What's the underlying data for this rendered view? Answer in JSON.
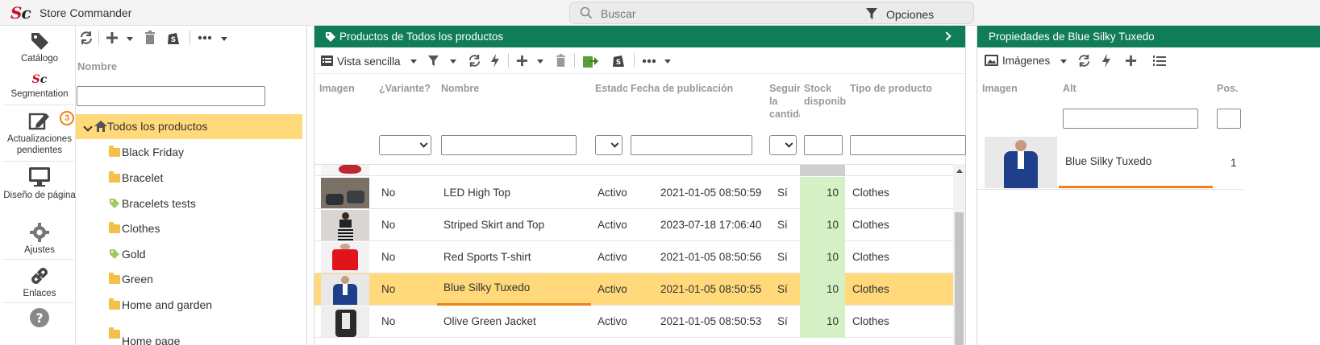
{
  "app": {
    "logo": "Sc",
    "title": "Store Commander"
  },
  "search": {
    "placeholder": "Buscar",
    "options_label": "Opciones"
  },
  "nav": [
    {
      "label": "Catálogo",
      "icon": "tag-icon"
    },
    {
      "label": "Segmentation",
      "icon": "sc-logo-icon"
    },
    {
      "label": "Actualizaciones pendientes",
      "icon": "edit-icon",
      "badge": "3"
    },
    {
      "label": "Diseño de página",
      "icon": "monitor-icon"
    },
    {
      "label": "Ajustes",
      "icon": "gear-icon"
    },
    {
      "label": "Enlaces",
      "icon": "link-icon"
    },
    {
      "label": "",
      "icon": "help-icon"
    }
  ],
  "tree": {
    "column_header": "Nombre",
    "items": [
      {
        "label": "Todos los productos",
        "type": "home",
        "selected": true
      },
      {
        "label": "Black Friday",
        "type": "folder"
      },
      {
        "label": "Bracelet",
        "type": "folder"
      },
      {
        "label": "Bracelets tests",
        "type": "tag"
      },
      {
        "label": "Clothes",
        "type": "folder"
      },
      {
        "label": "Gold",
        "type": "tag"
      },
      {
        "label": "Green",
        "type": "folder"
      },
      {
        "label": "Home and garden",
        "type": "folder"
      },
      {
        "label": "Home page",
        "type": "folder"
      }
    ]
  },
  "products": {
    "title": "Productos de Todos los productos",
    "view_label": "Vista sencilla",
    "columns": {
      "image": "Imagen",
      "variant": "¿Variante?",
      "name": "Nombre",
      "status": "Estado",
      "date": "Fecha de publicación",
      "track": "Seguir la cantidad",
      "stock": "Stock disponible",
      "type": "Tipo de producto"
    },
    "rows": [
      {
        "variant": "No",
        "name": "LED High Top",
        "status": "Activo",
        "date": "2021-01-05 08:50:59",
        "track": "Sí",
        "stock": "10",
        "type": "Clothes",
        "thumb": "shoes"
      },
      {
        "variant": "No",
        "name": "Striped Skirt and Top",
        "status": "Activo",
        "date": "2023-07-18 17:06:40",
        "track": "Sí",
        "stock": "10",
        "type": "Clothes",
        "thumb": "skirt"
      },
      {
        "variant": "No",
        "name": "Red Sports T-shirt",
        "status": "Activo",
        "date": "2021-01-05 08:50:56",
        "track": "Sí",
        "stock": "10",
        "type": "Clothes",
        "thumb": "tshirt"
      },
      {
        "variant": "No",
        "name": "Blue Silky Tuxedo",
        "status": "Activo",
        "date": "2021-01-05 08:50:55",
        "track": "Sí",
        "stock": "10",
        "type": "Clothes",
        "thumb": "tuxedo",
        "selected": true
      },
      {
        "variant": "No",
        "name": "Olive Green Jacket",
        "status": "Activo",
        "date": "2021-01-05 08:50:53",
        "track": "Sí",
        "stock": "10",
        "type": "Clothes",
        "thumb": "jacket"
      }
    ]
  },
  "properties": {
    "title": "Propiedades de Blue Silky Tuxedo",
    "toolbar_label": "Imágenes",
    "columns": {
      "image": "Imagen",
      "alt": "Alt",
      "pos": "Pos."
    },
    "rows": [
      {
        "alt": "Blue Silky Tuxedo",
        "pos": "1"
      }
    ]
  },
  "colors": {
    "green_header": "#107c5a",
    "selected_row": "#ffd97a",
    "stock_cell": "#d4f0c4",
    "accent_orange": "#f0801a",
    "logo_red": "#c8102e"
  }
}
